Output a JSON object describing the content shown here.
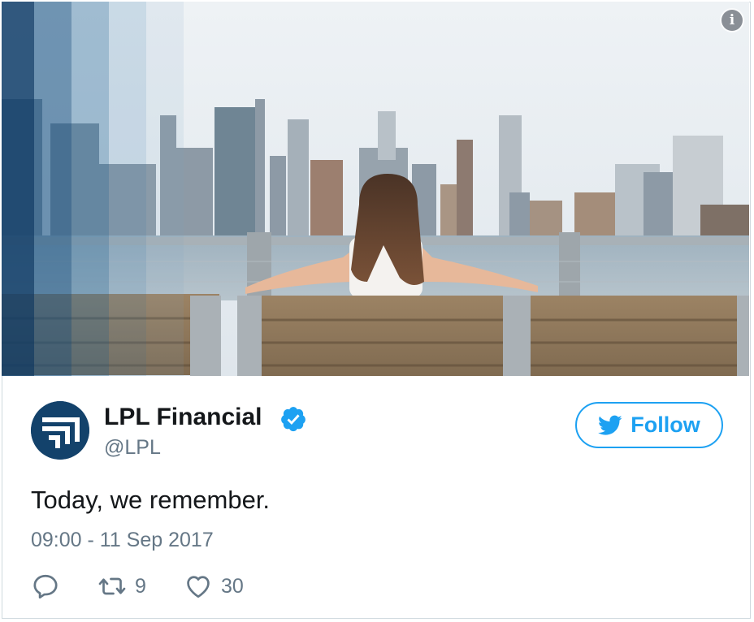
{
  "tweet": {
    "author_name": "LPL Financial",
    "handle": "@LPL",
    "text": "Today, we remember.",
    "timestamp": "09:00 - 11 Sep 2017",
    "follow_label": "Follow",
    "retweet_count": "9",
    "like_count": "30",
    "verified": true
  },
  "icons": {
    "info": "info-icon",
    "verified": "verified-badge-icon",
    "follow": "twitter-bird-icon",
    "reply": "reply-icon",
    "retweet": "retweet-icon",
    "like": "heart-icon"
  },
  "colors": {
    "accent": "#1da1f2",
    "text_primary": "#14171a",
    "text_secondary": "#657786",
    "avatar_bg": "#13426b"
  }
}
